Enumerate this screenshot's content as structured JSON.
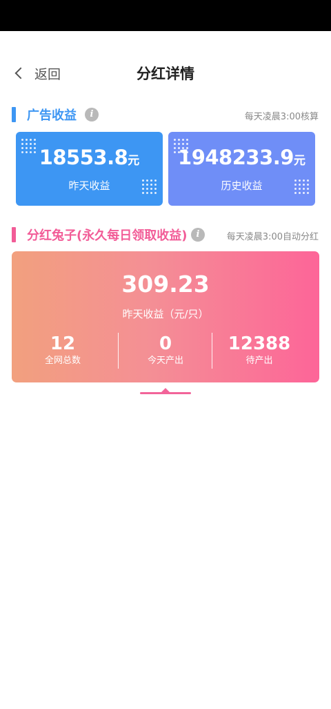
{
  "nav": {
    "back_label": "返回",
    "title": "分红详情"
  },
  "ad_section": {
    "title": "广告收益",
    "note": "每天凌晨3:00核算",
    "accent_color": "#3d96f3",
    "cards": [
      {
        "value": "18553.8",
        "unit": "元",
        "label": "昨天收益",
        "color": "#3d96f3"
      },
      {
        "value": "1948233.9",
        "unit": "元",
        "label": "历史收益",
        "color": "#6f8ef7"
      }
    ]
  },
  "rabbit_section": {
    "title": "分红兔子(永久每日领取收益)",
    "note": "每天凌晨3:00自动分红",
    "accent_color": "#f25c97",
    "card": {
      "value": "309.23",
      "label": "昨天收益（元/只）",
      "stats": [
        {
          "value": "12",
          "label": "全网总数"
        },
        {
          "value": "0",
          "label": "今天产出"
        },
        {
          "value": "12388",
          "label": "待产出"
        }
      ]
    }
  },
  "icons": {
    "back": "chevron-left-icon",
    "info": "info-icon",
    "decor": "dot-grid-icon"
  }
}
